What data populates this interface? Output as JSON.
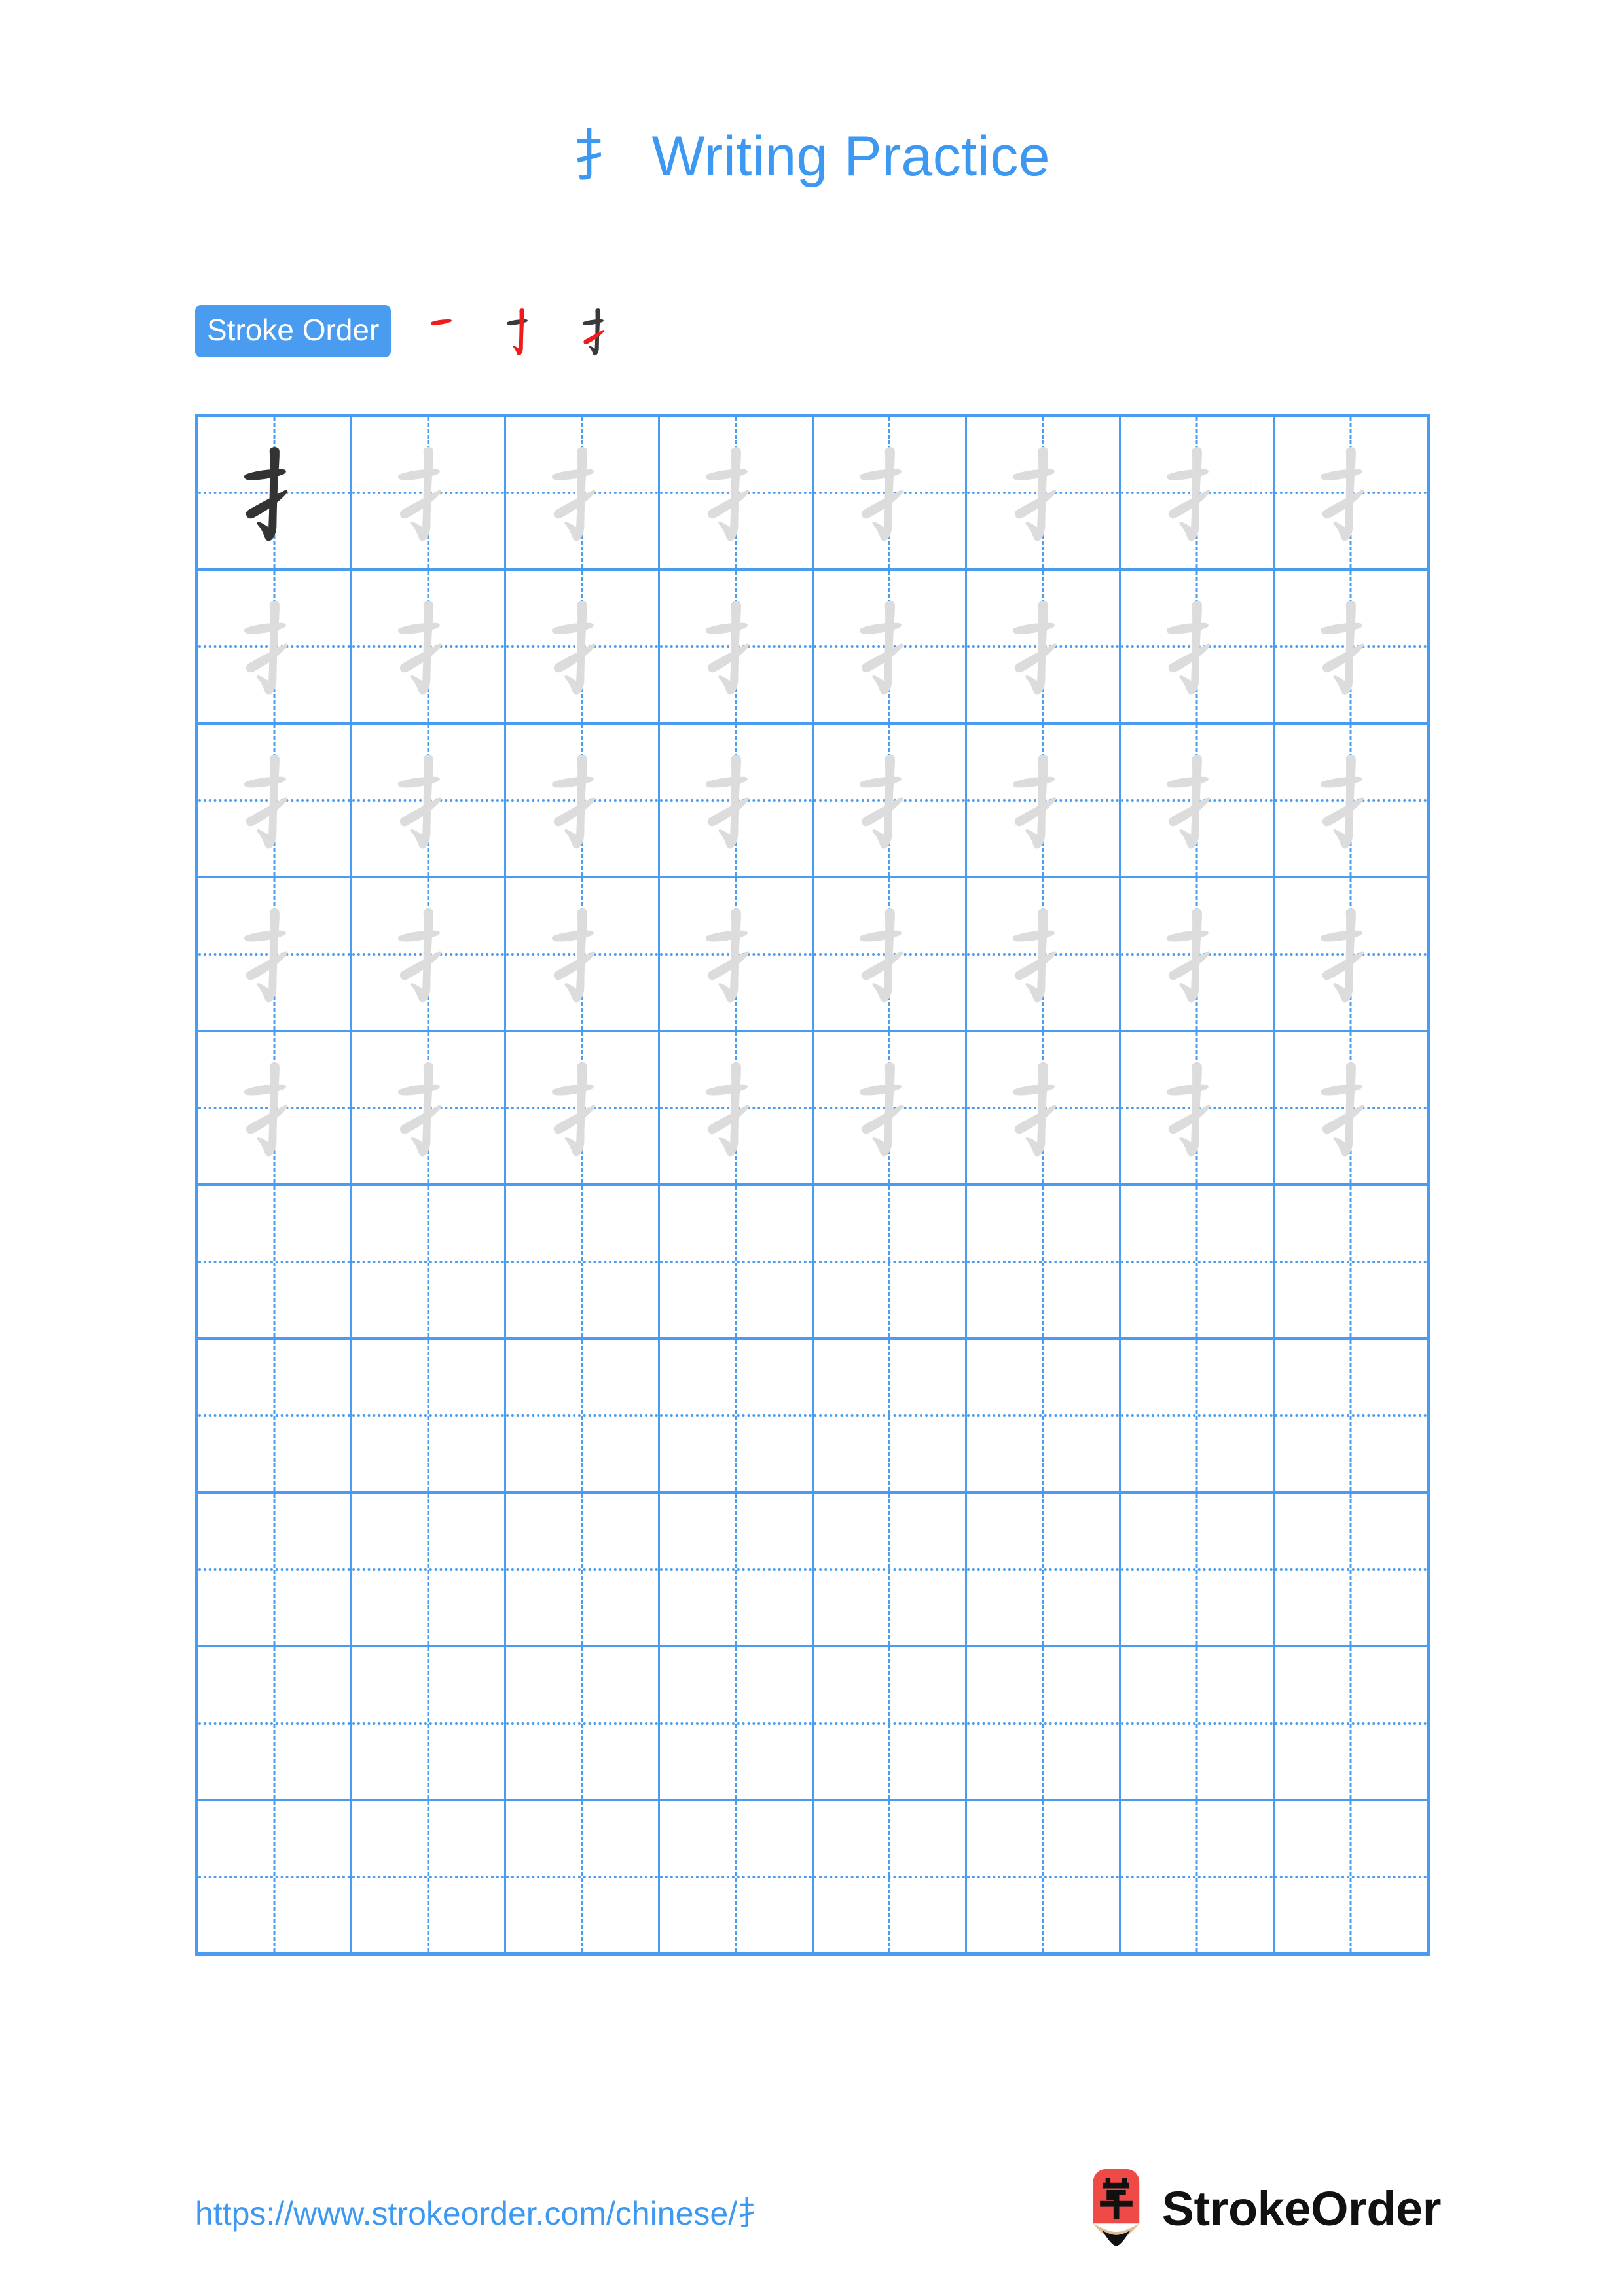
{
  "page": {
    "character": "扌",
    "title_suffix": "Writing Practice",
    "background": "#ffffff",
    "accent_blue": "#3d98f2",
    "grid_blue": "#4a9cf0"
  },
  "stroke_order": {
    "label": "Stroke Order",
    "badge_bg": "#4a9cf0",
    "badge_text_color": "#ffffff",
    "total_strokes": 3,
    "new_stroke_color": "#ee1c1c",
    "old_stroke_color": "#3a3a3a",
    "steps": [
      {
        "step": 1,
        "stroke_names": [
          "heng"
        ],
        "new_stroke_index": 0
      },
      {
        "step": 2,
        "stroke_names": [
          "heng",
          "shu-gou"
        ],
        "new_stroke_index": 1
      },
      {
        "step": 3,
        "stroke_names": [
          "heng",
          "shu-gou",
          "ti"
        ],
        "new_stroke_index": 2
      }
    ]
  },
  "grid": {
    "rows": 10,
    "columns": 8,
    "border_color": "#4a9cf0",
    "guide_style": "dashed-cross",
    "cells": [
      [
        "dark",
        "light",
        "light",
        "light",
        "light",
        "light",
        "light",
        "light"
      ],
      [
        "light",
        "light",
        "light",
        "light",
        "light",
        "light",
        "light",
        "light"
      ],
      [
        "light",
        "light",
        "light",
        "light",
        "light",
        "light",
        "light",
        "light"
      ],
      [
        "light",
        "light",
        "light",
        "light",
        "light",
        "light",
        "light",
        "light"
      ],
      [
        "light",
        "light",
        "light",
        "light",
        "light",
        "light",
        "light",
        "light"
      ],
      [
        "empty",
        "empty",
        "empty",
        "empty",
        "empty",
        "empty",
        "empty",
        "empty"
      ],
      [
        "empty",
        "empty",
        "empty",
        "empty",
        "empty",
        "empty",
        "empty",
        "empty"
      ],
      [
        "empty",
        "empty",
        "empty",
        "empty",
        "empty",
        "empty",
        "empty",
        "empty"
      ],
      [
        "empty",
        "empty",
        "empty",
        "empty",
        "empty",
        "empty",
        "empty",
        "empty"
      ],
      [
        "empty",
        "empty",
        "empty",
        "empty",
        "empty",
        "empty",
        "empty",
        "empty"
      ]
    ],
    "dark_glyph_color": "#333333",
    "light_glyph_color": "#dcdcdc"
  },
  "footer": {
    "url": "https://www.strokeorder.com/chinese/扌",
    "brand_name": "StrokeOrder",
    "logo_character": "字",
    "logo_body_color": "#ef4a48",
    "logo_wood_color": "#e0bd93",
    "logo_tip_color": "#111111"
  }
}
